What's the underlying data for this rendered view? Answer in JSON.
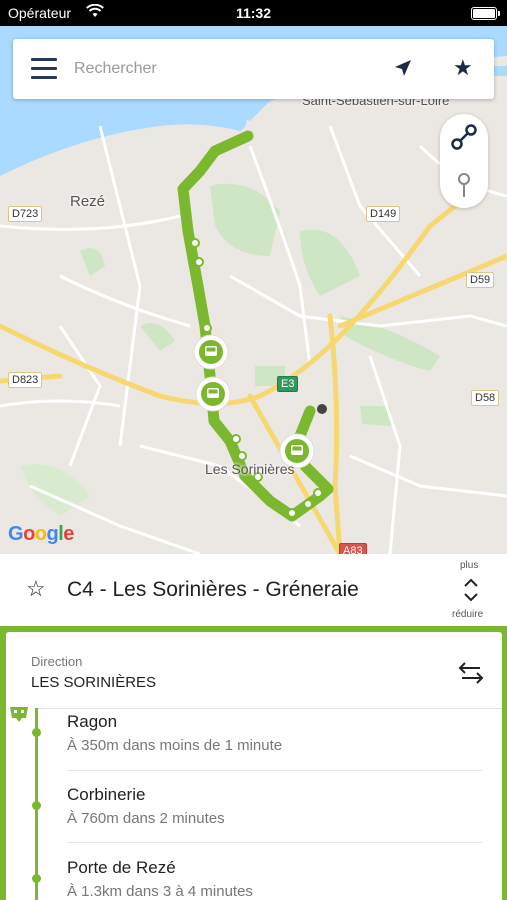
{
  "status_bar": {
    "carrier": "Opérateur",
    "time": "11:32"
  },
  "search": {
    "placeholder": "Rechercher"
  },
  "map": {
    "labels": {
      "rezé": "Rezé",
      "saint_sebastien": "Saint-Sébastien-sur-Loire",
      "les_sorinieres": "Les Sorinières"
    },
    "road_badges": [
      "D723",
      "D149",
      "D59",
      "D823",
      "E3",
      "D58",
      "A83"
    ],
    "attribution": "Google"
  },
  "line": {
    "title": "C4 - Les Sorinières - Gréneraie",
    "more_label": "plus",
    "less_label": "réduire"
  },
  "direction": {
    "label": "Direction",
    "value": "LES SORINIÈRES"
  },
  "stops": [
    {
      "name": "Ragon",
      "eta": "À 350m dans moins de 1 minute"
    },
    {
      "name": "Corbinerie",
      "eta": "À 760m dans 2 minutes"
    },
    {
      "name": "Porte de Rezé",
      "eta": "À 1.3km dans 3 à 4 minutes"
    }
  ],
  "colors": {
    "line": "#7cb82f",
    "accent": "#1c2b45"
  }
}
